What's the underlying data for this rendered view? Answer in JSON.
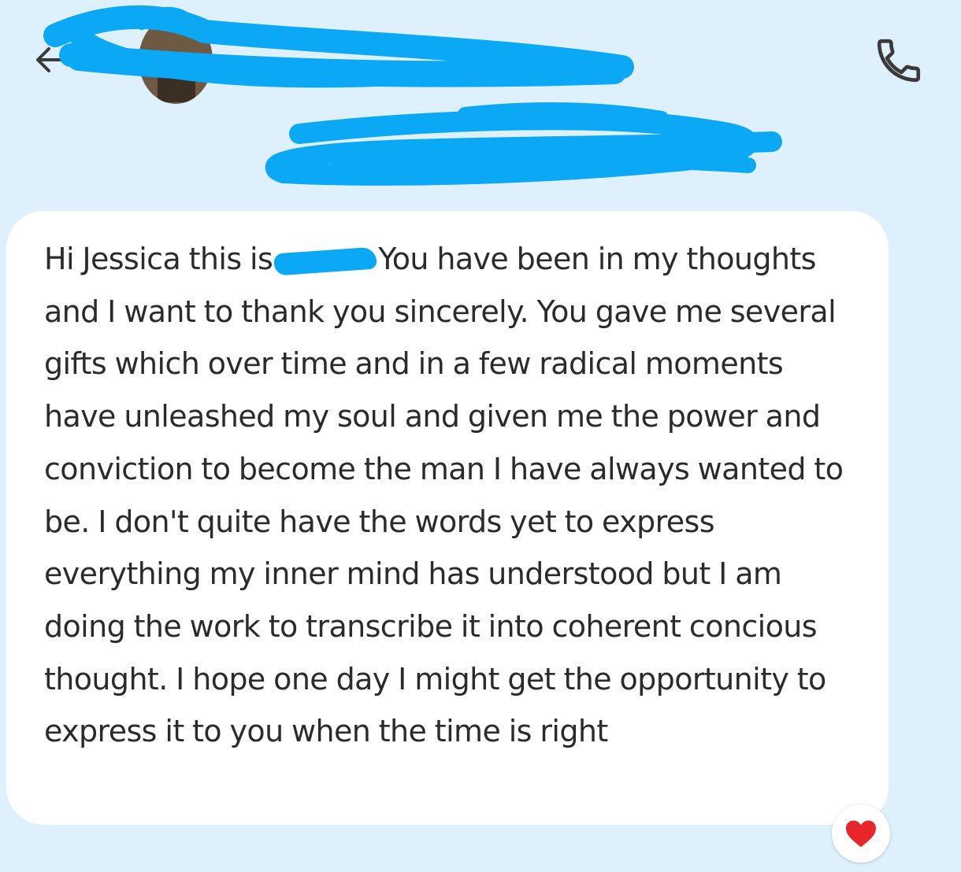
{
  "header": {
    "contact_name": "",
    "contact_subtitle": "",
    "back_icon": "arrow-left-icon",
    "call_icon": "phone-icon"
  },
  "message": {
    "text_before_redaction": "Hi Jessica this is",
    "text_after_redaction": "You have been in my thoughts and I want to thank you sincerely. You gave me several gifts which over time and in a few radical moments have unleashed my soul and given me the power and conviction to become the man I have always wanted to be. I don't quite have the words yet to express everything my inner mind has understood but I am doing the work to transcribe it into coherent concious thought. I hope one day I might get the opportunity to express it to you when the time is right"
  },
  "reaction": {
    "icon": "red-heart-icon",
    "color": "#e8262b"
  },
  "colors": {
    "background": "#dff0fd",
    "bubble": "#ffffff",
    "redaction": "#0aa8f5"
  }
}
